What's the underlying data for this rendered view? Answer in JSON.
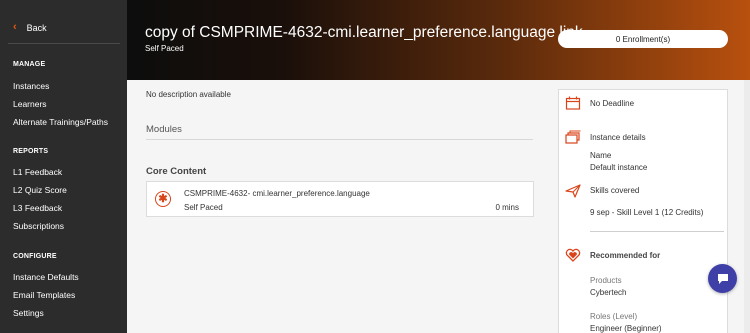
{
  "sidebar": {
    "back_label": "Back",
    "sections": [
      {
        "title": "MANAGE",
        "items": [
          "Instances",
          "Learners",
          "Alternate Trainings/Paths"
        ]
      },
      {
        "title": "REPORTS",
        "items": [
          "L1 Feedback",
          "L2 Quiz Score",
          "L3 Feedback",
          "Subscriptions"
        ]
      },
      {
        "title": "CONFIGURE",
        "items": [
          "Instance Defaults",
          "Email Templates",
          "Settings"
        ]
      }
    ]
  },
  "header": {
    "title": "copy of CSMPRIME-4632-cmi.learner_preference.language link",
    "type": "Self Paced",
    "enroll_label": "0 Enrollment(s)"
  },
  "main": {
    "description": "No description available",
    "modules_label": "Modules",
    "core_label": "Core Content",
    "module": {
      "name": "CSMPRIME-4632- cmi.learner_preference.language",
      "type": "Self Paced",
      "duration": "0 mins"
    }
  },
  "panel": {
    "deadline": "No Deadline",
    "instance_heading": "Instance details",
    "instance_name_label": "Name",
    "instance_name_value": "Default instance",
    "skills_heading": "Skills covered",
    "skill_value": "9 sep - Skill Level 1 (12 Credits)",
    "recommended_heading": "Recommended for",
    "products_label": "Products",
    "products_value": "Cybertech",
    "roles_label": "Roles (Level)",
    "roles_value": "Engineer (Beginner)"
  },
  "colors": {
    "accent": "#d9441a",
    "sidebar_bg": "#2c2c2c",
    "chat_fab": "#3f3fa8"
  },
  "icons": {
    "back": "chevron-left-icon",
    "module": "asterisk-circle-icon",
    "deadline": "calendar-icon",
    "instance": "stacked-cards-icon",
    "skills": "paper-plane-icon",
    "recommended": "heart-icon",
    "chat": "chat-bubble-icon"
  }
}
